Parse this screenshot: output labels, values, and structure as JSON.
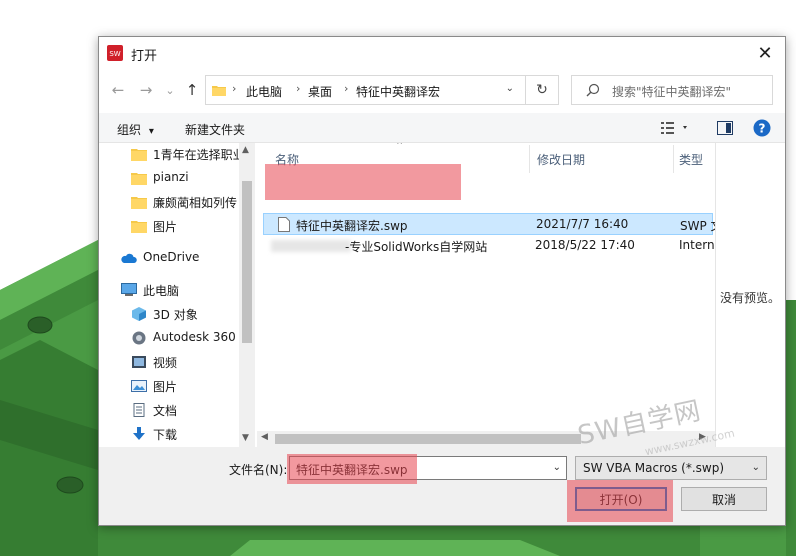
{
  "dialog": {
    "title": "打开",
    "close_glyph": "✕"
  },
  "nav": {
    "back_glyph": "←",
    "forward_glyph": "→",
    "dropdown_glyph": "⌄",
    "up_glyph": "↑",
    "breadcrumb": [
      "此电脑",
      "桌面",
      "特征中英翻译宏"
    ],
    "breadcrumb_sep": "›",
    "refresh_glyph": "↻",
    "search_placeholder": "搜索\"特征中英翻译宏\""
  },
  "toolbar": {
    "organize_label": "组织",
    "organize_caret": "▾",
    "new_folder_label": "新建文件夹",
    "help_glyph": "?"
  },
  "sidebar": {
    "items": [
      {
        "label": "1青年在选择职业",
        "icon": "folder-icon"
      },
      {
        "label": "pianzi",
        "icon": "folder-icon"
      },
      {
        "label": "廉颇蔺相如列传",
        "icon": "folder-icon"
      },
      {
        "label": "图片",
        "icon": "folder-icon"
      },
      {
        "label": "OneDrive",
        "icon": "cloud-icon"
      },
      {
        "label": "此电脑",
        "icon": "computer-icon"
      },
      {
        "label": "3D 对象",
        "icon": "cube-icon"
      },
      {
        "label": "Autodesk 360",
        "icon": "autodesk-icon"
      },
      {
        "label": "视频",
        "icon": "video-icon"
      },
      {
        "label": "图片",
        "icon": "pictures-icon"
      },
      {
        "label": "文档",
        "icon": "document-icon"
      },
      {
        "label": "下载",
        "icon": "download-icon"
      }
    ]
  },
  "file_list": {
    "columns": [
      "名称",
      "修改日期",
      "类型"
    ],
    "rows": [
      {
        "name": "特征中英翻译宏.swp",
        "date": "2021/7/7 16:40",
        "type": "SWP 文",
        "selected": true
      },
      {
        "name": "-专业SolidWorks自学网站",
        "date": "2018/5/22 17:40",
        "type": "Intern",
        "selected": false
      }
    ]
  },
  "preview": {
    "text": "没有预览。"
  },
  "bottom": {
    "filename_label": "文件名(N):",
    "filename_value": "特征中英翻译宏.swp",
    "filetype_value": "SW VBA Macros (*.swp)",
    "open_label": "打开(O)",
    "cancel_label": "取消"
  },
  "watermark": {
    "main": "SW自学网",
    "sub": "www.swzxw.com"
  },
  "colors": {
    "accent": "#0078d7",
    "selection": "#cce8ff",
    "highlight": "#e84650",
    "cad_green": "#3e8a3e"
  }
}
